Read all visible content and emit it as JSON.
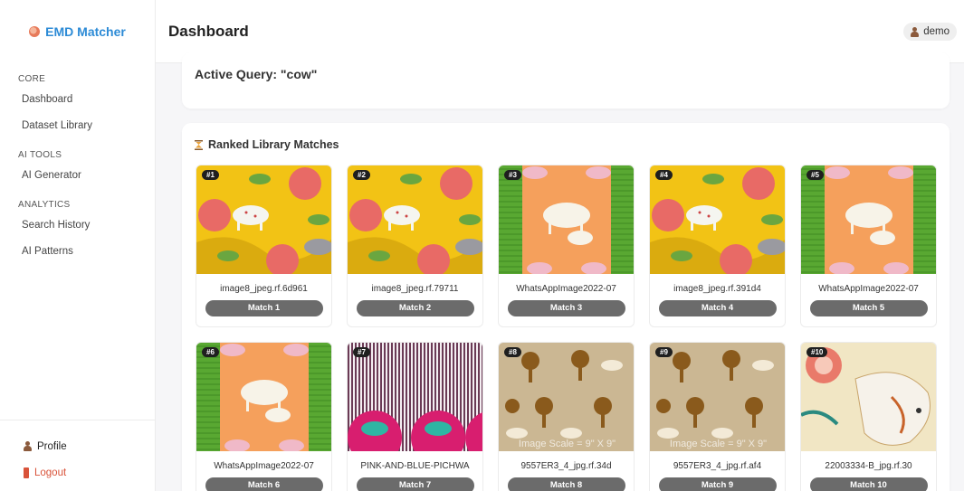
{
  "brand": {
    "name": "EMD Matcher",
    "icon": "brain-icon"
  },
  "header": {
    "title": "Dashboard",
    "user": "demo"
  },
  "sidebar": {
    "sections": [
      {
        "title": "CORE",
        "items": [
          "Dashboard",
          "Dataset Library"
        ]
      },
      {
        "title": "AI TOOLS",
        "items": [
          "AI Generator"
        ]
      },
      {
        "title": "ANALYTICS",
        "items": [
          "Search History",
          "AI Patterns"
        ]
      }
    ],
    "profile": "Profile",
    "logout": "Logout"
  },
  "query": {
    "text": "Active Query: \"cow\""
  },
  "results": {
    "title": "Ranked Library Matches",
    "items": [
      {
        "rank": "#1",
        "file": "image8_jpeg.rf.6d961",
        "button": "Match 1",
        "pattern": "yellow"
      },
      {
        "rank": "#2",
        "file": "image8_jpeg.rf.79711",
        "button": "Match 2",
        "pattern": "yellow"
      },
      {
        "rank": "#3",
        "file": "WhatsAppImage2022-07",
        "button": "Match 3",
        "pattern": "green-orange"
      },
      {
        "rank": "#4",
        "file": "image8_jpeg.rf.391d4",
        "button": "Match 4",
        "pattern": "yellow"
      },
      {
        "rank": "#5",
        "file": "WhatsAppImage2022-07",
        "button": "Match 5",
        "pattern": "green-orange"
      },
      {
        "rank": "#6",
        "file": "WhatsAppImage2022-07",
        "button": "Match 6",
        "pattern": "green-orange"
      },
      {
        "rank": "#7",
        "file": "PINK-AND-BLUE-PICHWA",
        "button": "Match 7",
        "pattern": "stripes-pink"
      },
      {
        "rank": "#8",
        "file": "9557ER3_4_jpg.rf.34d",
        "button": "Match 8",
        "pattern": "tan-trees",
        "overlay": "Image Scale = 9\" X 9\""
      },
      {
        "rank": "#9",
        "file": "9557ER3_4_jpg.rf.af4",
        "button": "Match 9",
        "pattern": "tan-trees",
        "overlay": "Image Scale = 9\" X 9\""
      },
      {
        "rank": "#10",
        "file": "22003334-B_jpg.rf.30",
        "button": "Match 10",
        "pattern": "painting"
      }
    ]
  }
}
